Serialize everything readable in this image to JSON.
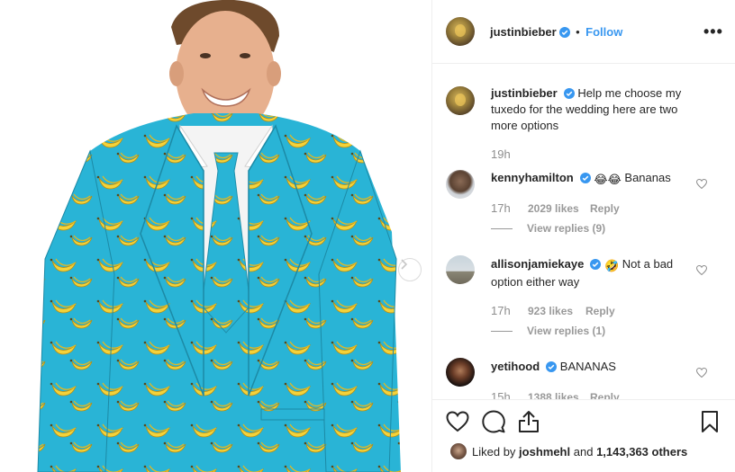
{
  "post": {
    "username": "justinbieber",
    "follow_label": "Follow",
    "separator": "•",
    "more_label": "•••",
    "caption": "Help me choose my tuxedo for the wedding here are two more options",
    "caption_time": "19h"
  },
  "comments": [
    {
      "username": "kennyhamilton",
      "emoji": [
        "😂",
        "😂"
      ],
      "text": "Bananas",
      "time": "17h",
      "likes": "2029 likes",
      "reply_label": "Reply",
      "view_replies": "View replies (9)"
    },
    {
      "username": "allisonjamiekaye",
      "emoji": [
        "🤣"
      ],
      "text": "Not a bad option either way",
      "time": "17h",
      "likes": "923 likes",
      "reply_label": "Reply",
      "view_replies": "View replies (1)"
    },
    {
      "username": "yetihood",
      "emoji": [],
      "text": "BANANAS",
      "time": "15h",
      "likes": "1388 likes",
      "reply_label": "Reply"
    }
  ],
  "likes_summary": {
    "prefix": "Liked by",
    "user": "joshmehl",
    "and": "and",
    "count": "1,143,363 others"
  },
  "icons": {
    "like": "heart-icon",
    "comment": "comment-icon",
    "share": "share-icon",
    "save": "bookmark-icon",
    "next": "chevron-right-icon",
    "verified": "verified-badge-icon"
  },
  "colors": {
    "suit": "#29b4d6",
    "banana": "#f4d23a",
    "link": "#3897f0",
    "verified": "#3897f0"
  }
}
